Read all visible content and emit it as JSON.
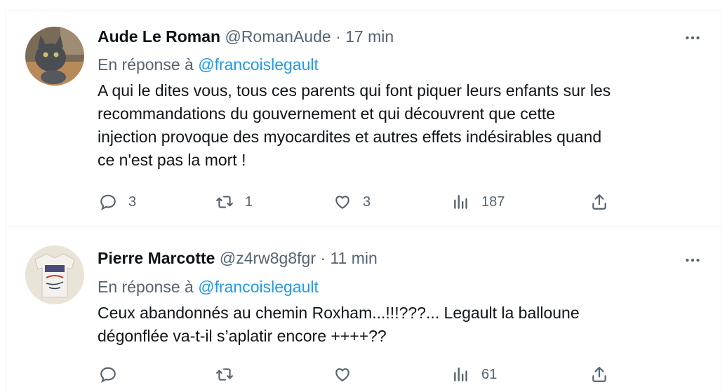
{
  "tweets": [
    {
      "author_name": "Aude Le Roman",
      "handle": "@RomanAude",
      "separator": "·",
      "time": "17 min",
      "reply_prefix": "En réponse à",
      "reply_mention": "@francoislegault",
      "text": "A qui le dites vous, tous ces parents qui font piquer leurs enfants sur les\nrecommandations du gouvernement et qui découvrent que cette\ninjection provoque des myocardites et autres effets indésirables quand\nce n'est pas la mort !",
      "replies": "3",
      "retweets": "1",
      "likes": "3",
      "views": "187",
      "avatar": "gray-cat-avatar"
    },
    {
      "author_name": "Pierre Marcotte",
      "handle": "@z4rw8g8fgr",
      "separator": "·",
      "time": "11 min",
      "reply_prefix": "En réponse à",
      "reply_mention": "@francoislegault",
      "text": "Ceux abandonnés au chemin Roxham...!!!???... Legault la balloune\ndégonflée va-t-il s’aplatir encore ++++??",
      "replies": "",
      "retweets": "",
      "likes": "",
      "views": "61",
      "avatar": "tshirt-avatar"
    }
  ],
  "colors": {
    "text": "#0f1419",
    "secondary": "#536471",
    "link": "#1d9bf0",
    "border": "#eff3f4"
  },
  "icons": [
    "more-icon",
    "reply-icon",
    "retweet-icon",
    "like-icon",
    "views-icon",
    "share-icon"
  ]
}
